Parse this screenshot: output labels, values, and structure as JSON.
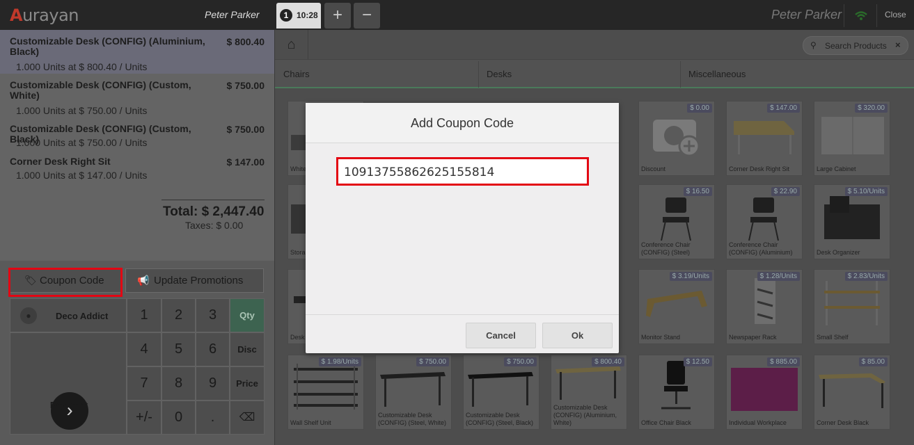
{
  "header": {
    "logo_text": "urayan",
    "logo_mark": "A",
    "user_left": "Peter Parker",
    "order_tab_number": "1",
    "order_tab_time": "10:28",
    "add_label": "+",
    "remove_label": "−",
    "user_right": "Peter Parker",
    "close_label": "Close"
  },
  "order": {
    "lines": [
      {
        "name": "Customizable Desk (CONFIG) (Aluminium, Black)",
        "price": "$ 800.40",
        "info": "1.000 Units at $ 800.40 / Units"
      },
      {
        "name": "Customizable Desk (CONFIG) (Custom, White)",
        "price": "$ 750.00",
        "info": "1.000 Units at $ 750.00 / Units"
      },
      {
        "name": "Customizable Desk (CONFIG) (Custom, Black)",
        "price": "$ 750.00",
        "info": "1.000 Units at $ 750.00 / Units"
      },
      {
        "name": "Corner Desk Right Sit",
        "price": "$ 147.00",
        "info": "1.000 Units at $ 147.00 / Units"
      }
    ],
    "total": "Total: $ 2,447.40",
    "taxes": "Taxes: $ 0.00"
  },
  "controls": {
    "coupon_label": "Coupon Code",
    "promotions_label": "Update Promotions",
    "customer": "Deco Addict",
    "payment": "Payment",
    "keys": [
      "1",
      "2",
      "3",
      "Qty",
      "4",
      "5",
      "6",
      "Disc",
      "7",
      "8",
      "9",
      "Price",
      "+/-",
      "0",
      ".",
      "⌫"
    ]
  },
  "products": {
    "search_placeholder": "Search Products",
    "categories": [
      "Chairs",
      "Desks",
      "Miscellaneous"
    ],
    "row1": [
      {
        "name": "White",
        "price": ""
      },
      {
        "name": "Discount",
        "price": "$ 0.00"
      },
      {
        "name": "Corner Desk Right Sit",
        "price": "$ 147.00"
      },
      {
        "name": "Large Cabinet",
        "price": "$ 320.00"
      }
    ],
    "row2": [
      {
        "name": "Stora",
        "price": ""
      },
      {
        "name": "Conference Chair (CONFIG) (Steel)",
        "price": "$ 16.50"
      },
      {
        "name": "Conference Chair (CONFIG) (Aluminium)",
        "price": "$ 22.90"
      },
      {
        "name": "Desk Organizer",
        "price": "$ 5.10/Units"
      }
    ],
    "row3": [
      {
        "name": "Desk",
        "price": ""
      },
      {
        "name": "Monitor Stand",
        "price": "$ 3.19/Units"
      },
      {
        "name": "Newspaper Rack",
        "price": "$ 1.28/Units"
      },
      {
        "name": "Small Shelf",
        "price": "$ 2.83/Units"
      }
    ],
    "row4": [
      {
        "name": "Wall Shelf Unit",
        "price": "$ 1.98/Units"
      },
      {
        "name": "Customizable Desk (CONFIG) (Steel, White)",
        "price": "$ 750.00"
      },
      {
        "name": "Customizable Desk (CONFIG) (Steel, Black)",
        "price": "$ 750.00"
      },
      {
        "name": "Customizable Desk (CONFIG) (Aluminium, White)",
        "price": "$ 800.40"
      },
      {
        "name": "Office Chair Black",
        "price": "$ 12.50"
      },
      {
        "name": "Individual Workplace",
        "price": "$ 885.00"
      },
      {
        "name": "Corner Desk Black",
        "price": "$ 85.00"
      }
    ]
  },
  "modal": {
    "title": "Add Coupon Code",
    "value": "10913755862625155814",
    "cancel": "Cancel",
    "ok": "Ok"
  }
}
